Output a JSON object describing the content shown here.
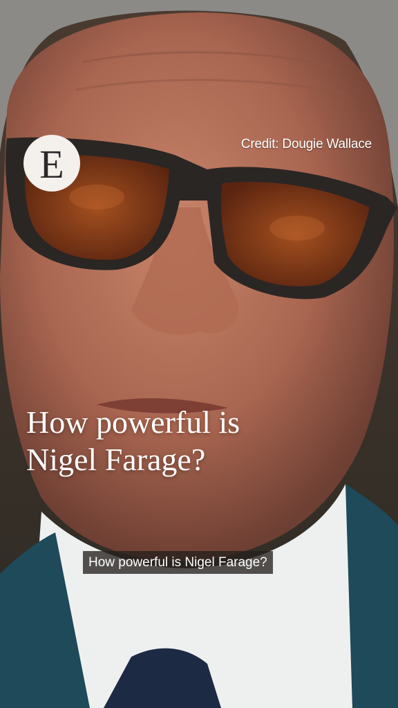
{
  "logo": {
    "letter": "E"
  },
  "credit": "Credit: Dougie Wallace",
  "headline": {
    "line1": "How powerful is",
    "line2": "Nigel Farage?"
  },
  "caption": "How powerful is Nigel Farage?",
  "colors": {
    "skin": "#b5735c",
    "suit": "#1e4a5a",
    "shirt": "#eef0f0",
    "lens": "#8a3a14",
    "frame": "#2a2624"
  }
}
